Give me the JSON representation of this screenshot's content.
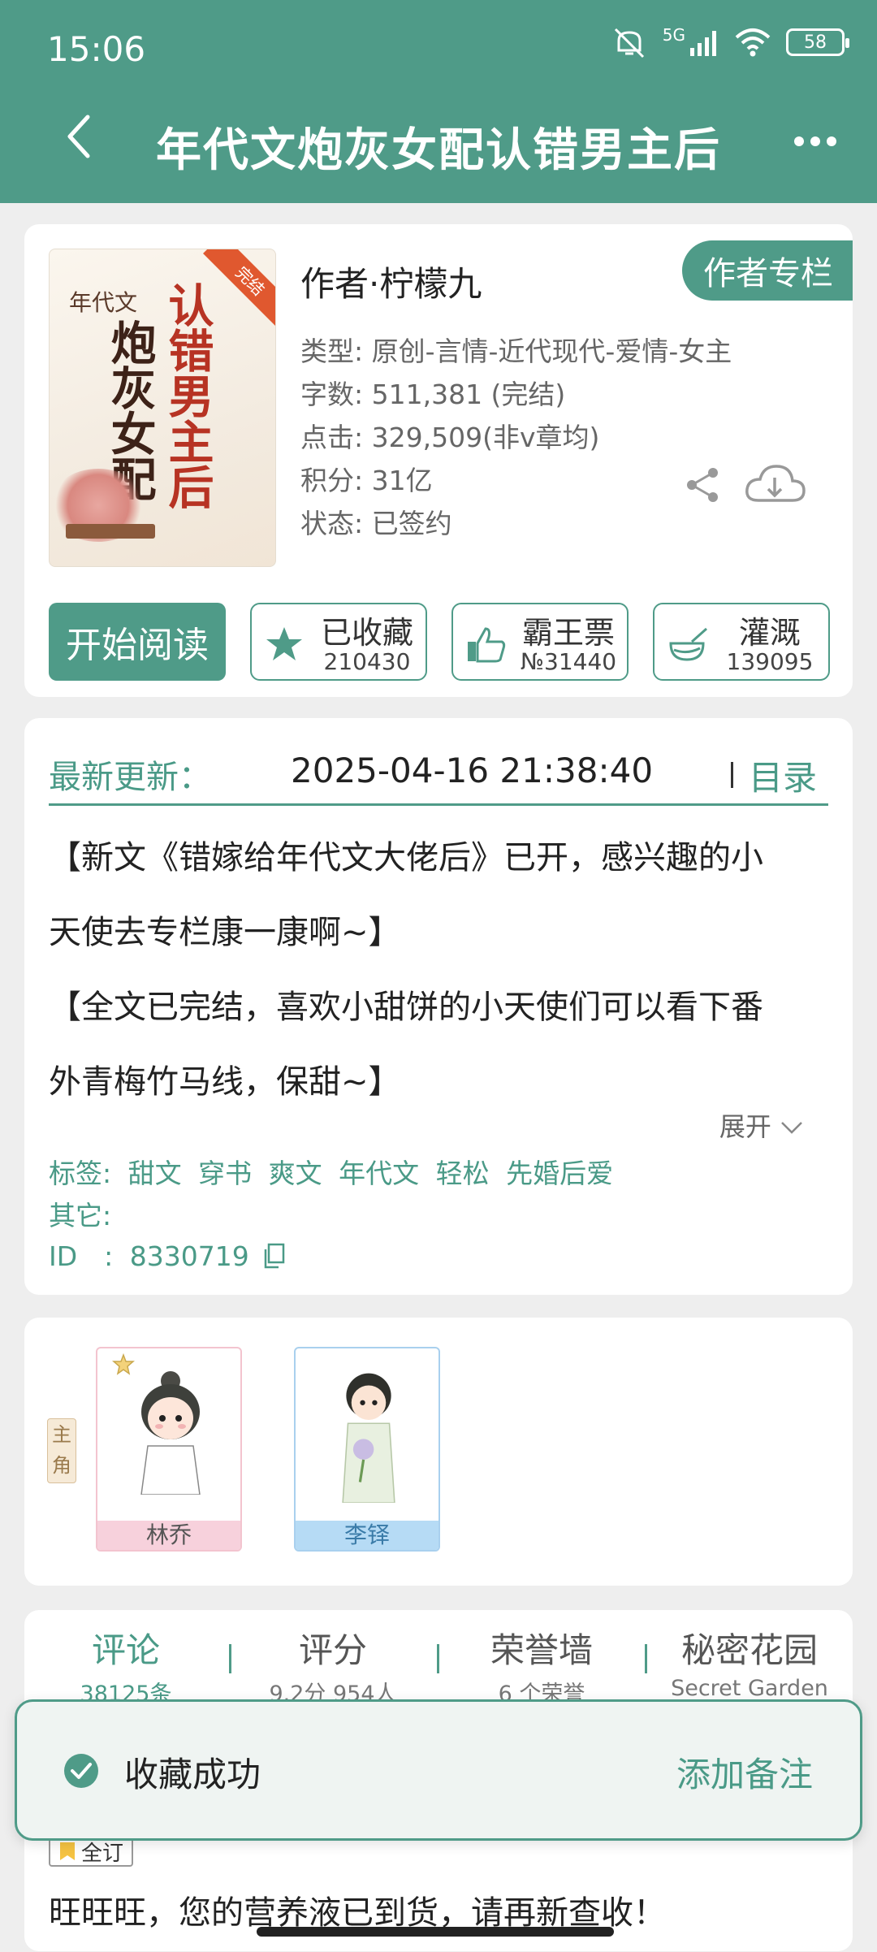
{
  "status_bar": {
    "time": "15:06",
    "network": "5G",
    "battery": "58"
  },
  "header": {
    "title": "年代文炮灰女配认错男主后"
  },
  "book": {
    "cover": {
      "badge": "完结",
      "small_title": "年代文",
      "title_left": "炮灰女配",
      "title_right": "认错男主后"
    },
    "author": "作者·柠檬九",
    "author_column_label": "作者专栏",
    "meta": [
      "类型: 原创-言情-近代现代-爱情-女主",
      "字数: 511,381 (完结)",
      "点击: 329,509(非v章均)",
      "积分: 31亿",
      "状态: 已签约"
    ],
    "read_button": "开始阅读",
    "stats": [
      {
        "icon": "star-icon",
        "label": "已收藏",
        "count": "210430"
      },
      {
        "icon": "thumbs-up-icon",
        "label": "霸王票",
        "count": "№31440"
      },
      {
        "icon": "nutrient-icon",
        "label": "灌溉",
        "count": "139095"
      }
    ]
  },
  "update": {
    "label": "最新更新：",
    "datetime": "2025-04-16 21:38:40",
    "toc_label": "目录",
    "notices": [
      "【新文《错嫁给年代文大佬后》已开，感兴趣的小",
      "天使去专栏康一康啊~】",
      "【全文已完结，喜欢小甜饼的小天使们可以看下番",
      "外青梅竹马线，保甜~】"
    ],
    "expand_label": "展开",
    "tags_label": "标签:",
    "tags": [
      "甜文",
      "穿书",
      "爽文",
      "年代文",
      "轻松",
      "先婚后爱"
    ],
    "other_label": "其它:",
    "id_label": "ID　:",
    "id_value": "8330719"
  },
  "characters": {
    "lead_tag": "主角",
    "items": [
      {
        "name": "林乔"
      },
      {
        "name": "李铎"
      }
    ]
  },
  "tabs": [
    {
      "label": "评论",
      "sub": "38125条",
      "active": true
    },
    {
      "label": "评分",
      "sub": "9.2分 954人",
      "active": false
    },
    {
      "label": "荣誉墙",
      "sub": "6 个荣誉",
      "active": false
    },
    {
      "label": "秘密花园",
      "sub": "Secret Garden",
      "active": false
    }
  ],
  "full_subscribe_badge": "全订",
  "promo_text": "旺旺旺，您的营养液已到货，请再新查收！",
  "toast": {
    "message": "收藏成功",
    "action": "添加备注"
  },
  "colors": {
    "accent": "#4f9b88",
    "badge": "#e0582f"
  }
}
